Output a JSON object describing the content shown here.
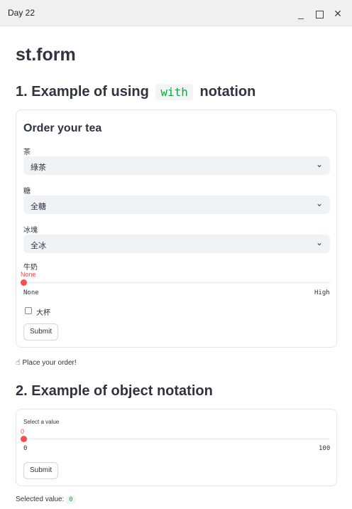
{
  "window": {
    "title": "Day 22",
    "minimize": "_",
    "close": "✕"
  },
  "page": {
    "title": "st.form"
  },
  "section1": {
    "heading_pre": "1. Example of using",
    "heading_code": "with",
    "heading_post": "notation",
    "form": {
      "heading": "Order your tea",
      "tea": {
        "label": "茶",
        "value": "綠茶"
      },
      "sugar": {
        "label": "糖",
        "value": "全糖"
      },
      "ice": {
        "label": "冰塊",
        "value": "全冰"
      },
      "milk": {
        "label": "牛奶",
        "value": "None",
        "min": "None",
        "max": "High",
        "position": 0
      },
      "large": {
        "label": "大杯",
        "checked": false
      },
      "submit": "Submit"
    },
    "note": "Place your order!",
    "note_icon": "pointing-hand-icon"
  },
  "section2": {
    "heading": "2. Example of object notation",
    "form": {
      "slider": {
        "label": "Select a value",
        "value": "0",
        "min": "0",
        "max": "100"
      },
      "submit": "Submit"
    },
    "result_label": "Selected value:",
    "result_value": "0"
  },
  "colors": {
    "accent": "#ff4b4b",
    "code_green": "#09ab3b",
    "select_bg": "#f0f2f6",
    "text": "#31333f"
  }
}
